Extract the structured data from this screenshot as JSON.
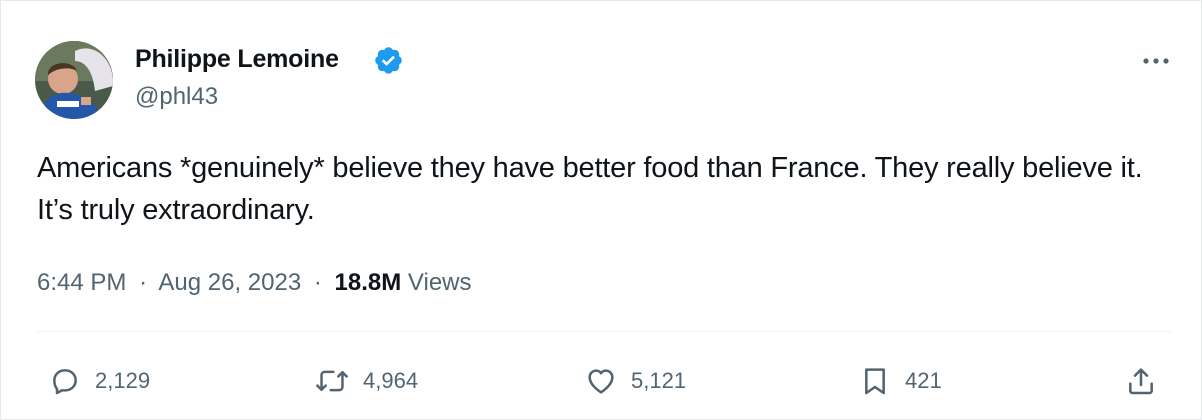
{
  "author": {
    "name": "Philippe Lemoine",
    "handle": "@phl43",
    "verified": true
  },
  "tweet": {
    "text": "Americans *genuinely* believe they have better food than France. They really believe it. It’s truly extraordinary.",
    "time": "6:44 PM",
    "date": "Aug 26, 2023",
    "separator": "·",
    "views_count": "18.8M",
    "views_label": "Views"
  },
  "actions": {
    "replies": "2,129",
    "reposts": "4,964",
    "likes": "5,121",
    "bookmarks": "421"
  },
  "colors": {
    "verified_badge": "#1d9bf0",
    "secondary_text": "#536471",
    "primary_text": "#0f1419"
  },
  "icons": {
    "more": "more-horizontal-icon",
    "reply": "speech-bubble-icon",
    "repost": "repost-arrows-icon",
    "like": "heart-icon",
    "bookmark": "bookmark-icon",
    "share": "share-upload-icon",
    "verified": "verified-badge-icon"
  }
}
